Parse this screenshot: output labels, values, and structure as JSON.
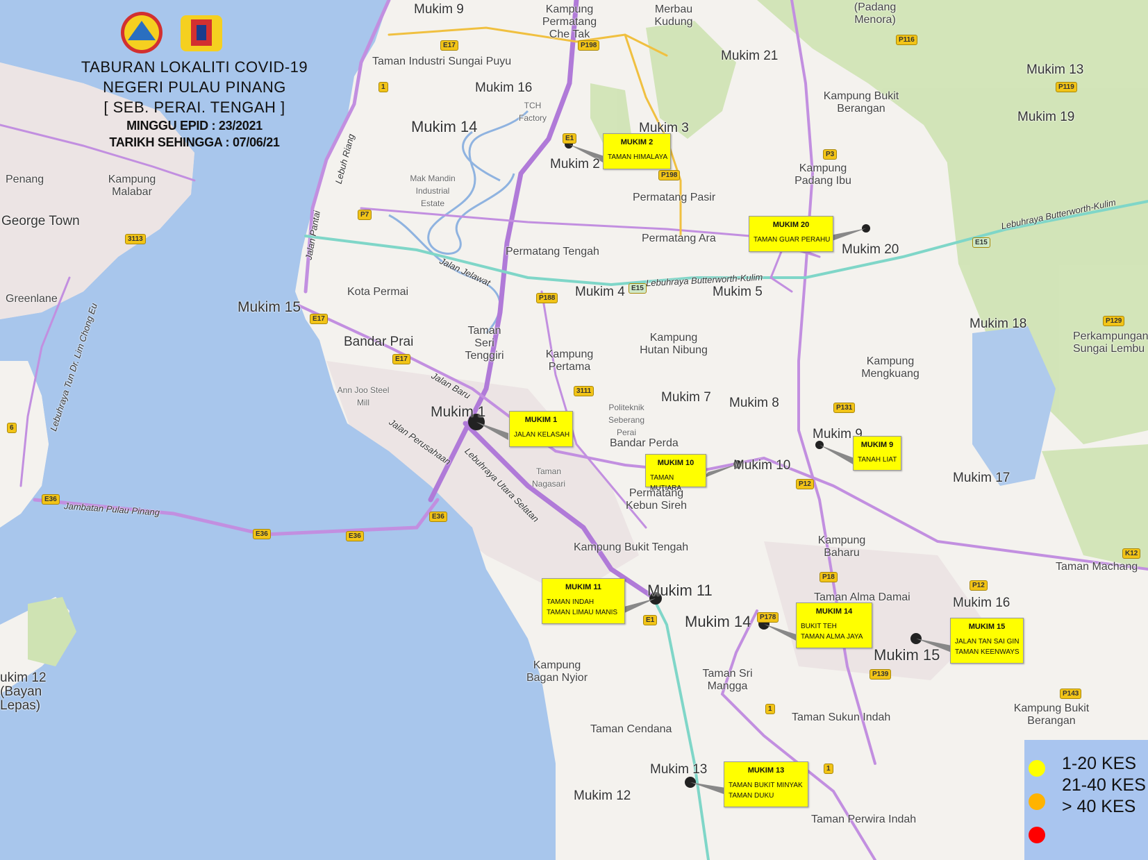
{
  "title": {
    "line1": "TABURAN LOKALITI COVID-19",
    "line2": "NEGERI PULAU PINANG",
    "line3": "[ SEB. PERAI. TENGAH ]",
    "line4": "MINGGU EPID : 23/2021",
    "line5": "TARIKH SEHINGGA : 07/06/21"
  },
  "callouts": [
    {
      "mukim": "MUKIM 2",
      "localities": [
        "TAMAN HIMALAYA"
      ]
    },
    {
      "mukim": "MUKIM 20",
      "localities": [
        "TAMAN GUAR PERAHU"
      ]
    },
    {
      "mukim": "MUKIM 1",
      "localities": [
        "JALAN KELASAH"
      ]
    },
    {
      "mukim": "MUKIM 10",
      "localities": [
        "TAMAN MUTIARA"
      ]
    },
    {
      "mukim": "MUKIM 9",
      "localities": [
        "TANAH LIAT"
      ]
    },
    {
      "mukim": "MUKIM 11",
      "localities": [
        "TAMAN INDAH",
        "TAMAN LIMAU MANIS"
      ]
    },
    {
      "mukim": "MUKIM 14",
      "localities": [
        "BUKIT TEH",
        "TAMAN ALMA JAYA"
      ]
    },
    {
      "mukim": "MUKIM 15",
      "localities": [
        "JALAN TAN SAI GIN",
        "TAMAN KEENWAYS"
      ]
    },
    {
      "mukim": "MUKIM 13",
      "localities": [
        "TAMAN BUKIT MINYAK",
        "TAMAN DUKU"
      ]
    }
  ],
  "legend": {
    "items": [
      {
        "label": "1-20 KES",
        "color": "#ffff00"
      },
      {
        "label": "21-40 KES",
        "color": "#ffb300"
      },
      {
        "label": "> 40 KES",
        "color": "#ff0000"
      }
    ]
  },
  "place_labels": [
    "Mukim 9",
    "Kampung Permatang Che Tak",
    "Merbau Kudung",
    "(Padang Menora)",
    "Mukim 21",
    "Mukim 13",
    "Taman Industri Sungai Puyu",
    "Mukim 16",
    "TCH Factory",
    "Kampung Bukit Berangan",
    "Mukim 19",
    "Mukim 14",
    "Mukim 3",
    "Mukim 2",
    "Kampung Padang Ibu",
    "Penang",
    "Kampung Malabar",
    "George Town",
    "Mak Mandin Industrial Estate",
    "Permatang Pasir",
    "Permatang Ara",
    "Mukim 20",
    "Permatang Tengah",
    "Greenlane",
    "Kota Permai",
    "Mukim 4",
    "Mukim 5",
    "Mukim 15",
    "Bandar Prai",
    "Taman Seri Tenggiri",
    "Kampung Hutan Nibung",
    "Mukim 18",
    "Perkampungan Sungai Lembu",
    "Kampung Pertama",
    "Kampung Mengkuang",
    "Ann Joo Steel Mill",
    "Politeknik Seberang Perai",
    "Mukim 7",
    "Mukim 8",
    "Mukim 1",
    "Bandar Perda",
    "Mukim 10",
    "Mukim 9",
    "Taman Nagasari",
    "Permatang Kebun Sireh",
    "Mukim 17",
    "Kampung Bukit Tengah",
    "Kampung Baharu",
    "Taman Machang",
    "Mukim 11",
    "Taman Alma Damai",
    "Mukim 16",
    "Mukim 14",
    "Mukim 15",
    "Kampung Bagan Nyior",
    "Taman Sri Mangga",
    "Taman Sukun Indah",
    "Kampung Bukit Berangan",
    "ukim 12",
    "(Bayan",
    "Lepas)",
    "Taman Cendana",
    "Mukim 13",
    "Mukim 12",
    "Taman Perwira Indah"
  ],
  "road_labels": [
    "Lebuh Riang",
    "Jalan Pantai",
    "Jalan Jelawat",
    "Jalan Baru",
    "Lebuhraya Tun Dr. Lim Chong Eu",
    "Jambatan Pulau Pinang",
    "Lebuhraya Utara Selatan",
    "Lebuhraya Butterworth-Kulim",
    "Lebuhraya Butterworth-Kulim",
    "Jalan Perusahaan"
  ],
  "shields": [
    "E17",
    "P198",
    "P116",
    "P119",
    "1",
    "E1",
    "P198",
    "P3",
    "P7",
    "3113",
    "E15",
    "E15",
    "P188",
    "E17",
    "E17",
    "P129",
    "3111",
    "P131",
    "P12",
    "K12",
    "P18",
    "P12",
    "E36",
    "E36",
    "E36",
    "E36",
    "6",
    "P178",
    "E1",
    "P139",
    "P143",
    "1",
    "1"
  ]
}
